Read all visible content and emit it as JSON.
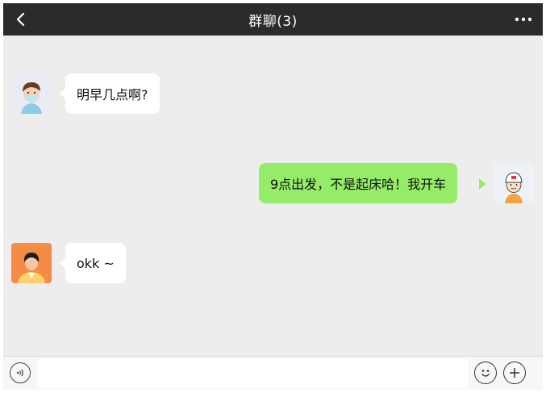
{
  "header": {
    "title": "群聊(3)",
    "back_icon": "chevron-left-icon",
    "more_icon": "more-dots-icon"
  },
  "messages": [
    {
      "side": "left",
      "text": "明早几点啊?",
      "avatar": "boy-mask-avatar"
    },
    {
      "side": "right",
      "text": "9点出发，不是起床哈！我开车",
      "avatar": "cap-boy-avatar"
    },
    {
      "side": "left",
      "text": "okk ~",
      "avatar": "orange-person-avatar"
    }
  ],
  "input_bar": {
    "voice_icon": "voice-icon",
    "input_value": "",
    "emoji_icon": "emoji-icon",
    "plus_icon": "plus-icon"
  },
  "colors": {
    "header_bg": "#2b2b2b",
    "chat_bg": "#ededed",
    "bubble_in": "#ffffff",
    "bubble_out": "#95ec69"
  }
}
